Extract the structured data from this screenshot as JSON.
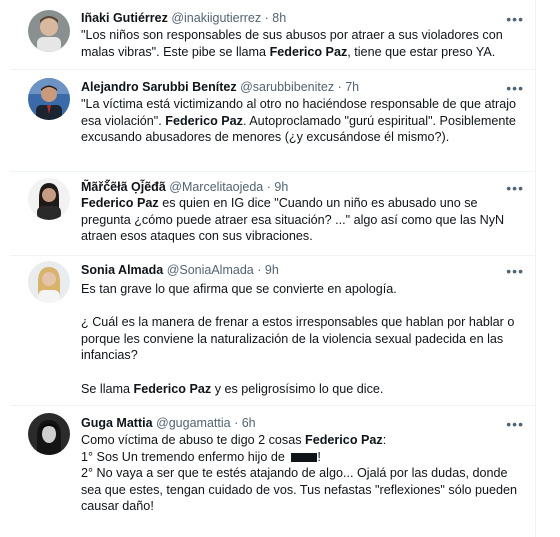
{
  "tweets": [
    {
      "name": "Iñaki Gutiérrez",
      "handle": "@inakiigutierrez",
      "time": "8h",
      "body": [
        [
          {
            "t": "\"Los niños son responsables de sus abusos por atraer a sus violadores con malas vibras\". Este pibe se llama ",
            "b": false
          },
          {
            "t": "Federico Paz",
            "b": true
          },
          {
            "t": ", tiene que estar preso YA.",
            "b": false
          }
        ]
      ]
    },
    {
      "name": "Alejandro Sarubbi Benítez",
      "handle": "@sarubbibenitez",
      "time": "7h",
      "body": [
        [
          {
            "t": "\"La víctima está victimizando al otro no haciéndose responsable de que atrajo esa violación\". ",
            "b": false
          },
          {
            "t": "Federico Paz",
            "b": true
          },
          {
            "t": ". Autoproclamado \"gurú espiritual\". Posiblemente excusando abusadores de menores (¿y excusándose él mismo?).",
            "b": false
          }
        ]
      ]
    },
    {
      "name": "M̃ãřč̃ẽłã Ọj̃ẽđã",
      "handle": "@Marcelitaojeda",
      "time": "9h",
      "body": [
        [
          {
            "t": "Federico Paz",
            "b": true
          },
          {
            "t": " es quien en IG dice \"Cuando un niño es abusado  uno se pregunta ¿cómo puede atraer esa situación? ...\" algo así como que las NyN atraen esos ataques con sus vibraciones.",
            "b": false
          }
        ]
      ]
    },
    {
      "name": "Sonia Almada",
      "handle": "@SoniaAlmada",
      "time": "9h",
      "body": [
        [
          {
            "t": "Es tan grave lo que afirma que  se convierte en apología.",
            "b": false
          }
        ],
        [],
        [
          {
            "t": "¿ Cuál es la manera de frenar a estos irresponsables que hablan por hablar o porque les conviene la naturalización de la violencia sexual padecida en las infancias?",
            "b": false
          }
        ],
        [],
        [
          {
            "t": "Se llama ",
            "b": false
          },
          {
            "t": "Federico Paz",
            "b": true
          },
          {
            "t": " y es peligrosísimo lo que dice.",
            "b": false
          }
        ]
      ]
    },
    {
      "name": "Guga Mattia",
      "handle": "@gugamattia",
      "time": "6h",
      "body": [
        [
          {
            "t": "Como víctima de abuso te digo 2 cosas ",
            "b": false
          },
          {
            "t": "Federico Paz",
            "b": true
          },
          {
            "t": ":",
            "b": false
          }
        ],
        [
          {
            "t": "1° Sos Un tremendo enfermo hijo de ",
            "b": false
          },
          {
            "t": "",
            "censor": true
          },
          {
            "t": "!",
            "b": false
          }
        ],
        [
          {
            "t": "2° No vaya a ser que te estés atajando de algo... Ojalá por las dudas, donde sea que estes, tengan cuidado de vos. Tus nefastas \"reflexiones\" sólo pueden causar daño!",
            "b": false
          }
        ]
      ]
    }
  ],
  "ui": {
    "more_glyph": "•••",
    "separator": "·"
  },
  "colors": {
    "text": "#0f1419",
    "secondary": "#536471",
    "divider": "#eff3f4"
  }
}
